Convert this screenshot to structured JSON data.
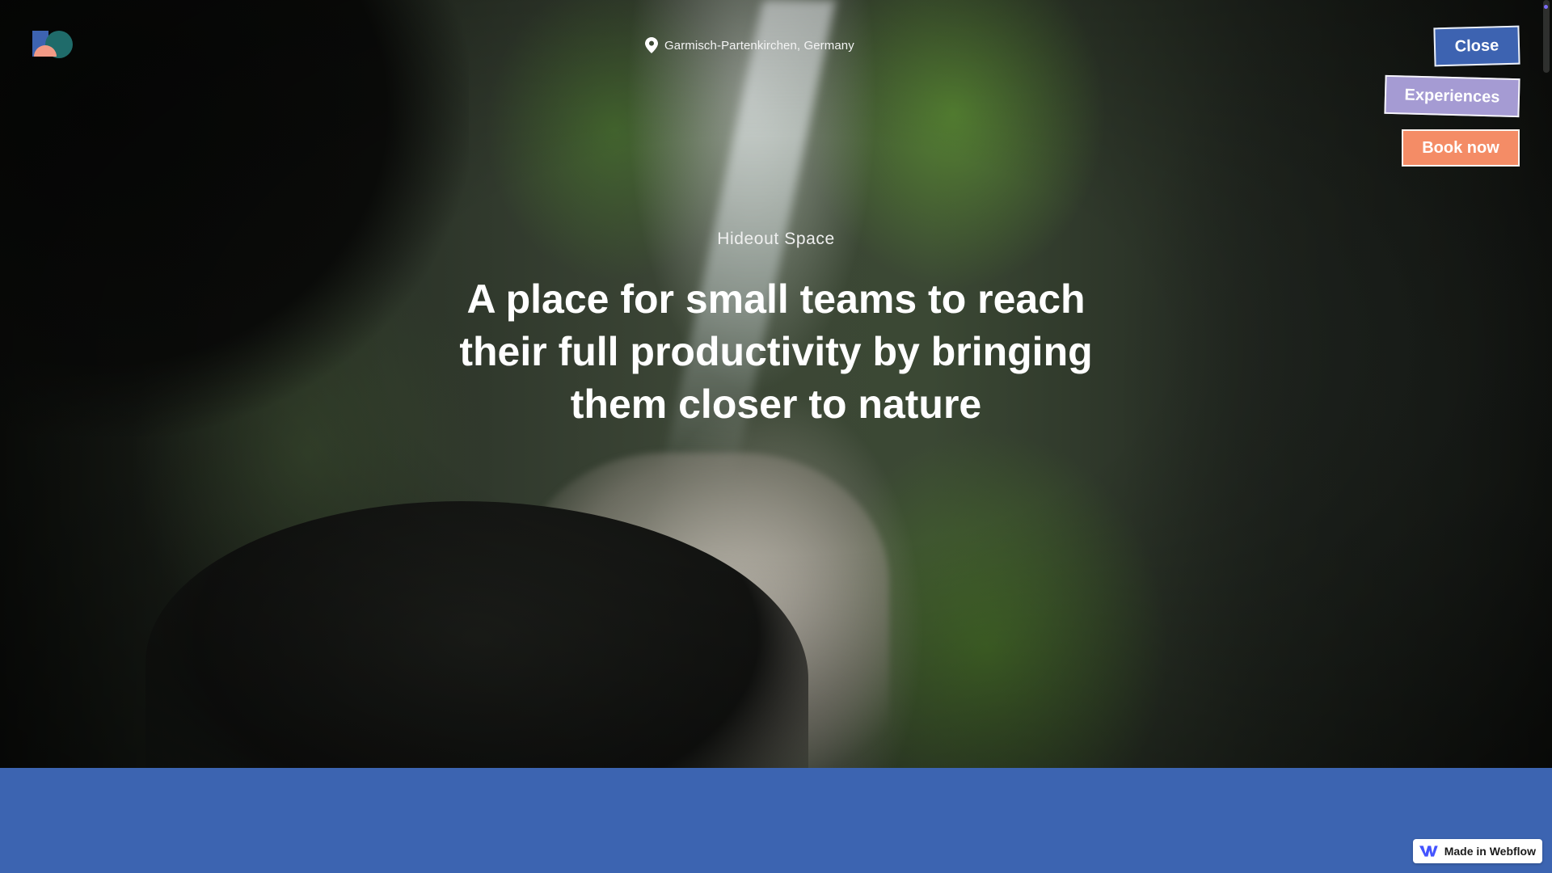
{
  "brand": {
    "logo_icon": "brand-logo-icon",
    "colors": {
      "logo_blue": "#3d63b1",
      "logo_teal": "#1f6b6a",
      "logo_coral": "#f29a86"
    }
  },
  "location": {
    "icon": "map-pin-icon",
    "text": "Garmisch-Partenkirchen, Germany"
  },
  "hero": {
    "tagline": "Hideout Space",
    "headline": "A place for small teams to reach their full productivity by bringing them closer to nature"
  },
  "nav": {
    "close_label": "Close",
    "experiences_label": "Experiences",
    "book_label": "Book now",
    "colors": {
      "close": "#3d63b1",
      "experiences": "#a59bd3",
      "book": "#f48c66"
    }
  },
  "footer_band": {
    "color": "#3c64b1"
  },
  "badge": {
    "icon": "webflow-icon",
    "label": "Made in Webflow"
  }
}
